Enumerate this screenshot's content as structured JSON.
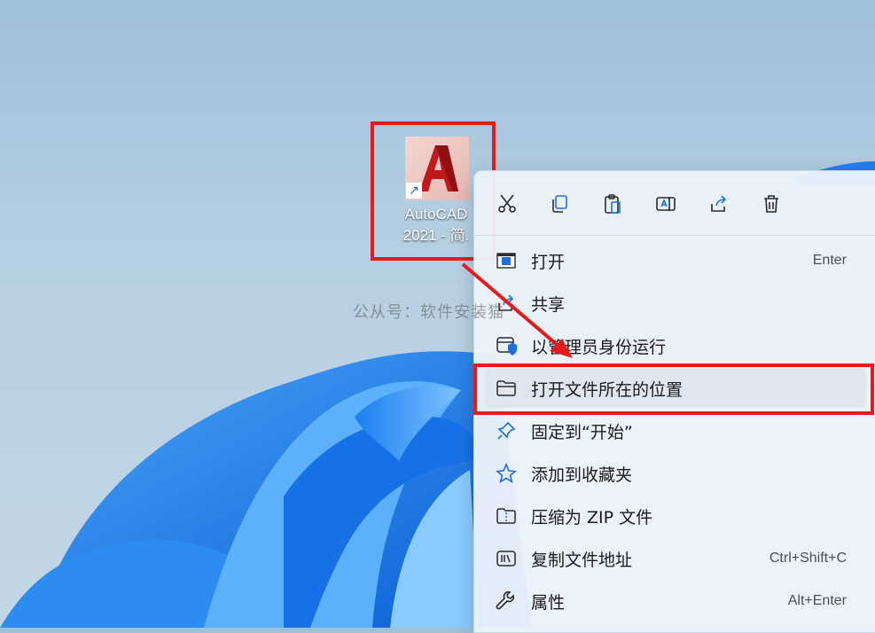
{
  "desktop": {
    "shortcut": {
      "name_line1": "AutoCAD",
      "name_line2": "2021 - 简.",
      "icon": "autocad-app-icon",
      "badge_icon": "shortcut-arrow-icon"
    },
    "watermark": "公从号：软件安装猫"
  },
  "context_menu": {
    "toolbar": [
      {
        "icon": "cut-icon"
      },
      {
        "icon": "copy-icon"
      },
      {
        "icon": "paste-icon"
      },
      {
        "icon": "rename-icon"
      },
      {
        "icon": "share-icon"
      },
      {
        "icon": "delete-icon"
      }
    ],
    "items": [
      {
        "label": "打开",
        "shortcut": "Enter",
        "icon": "open-app-icon"
      },
      {
        "label": "共享",
        "shortcut": "",
        "icon": "share-icon"
      },
      {
        "label": "以管理员身份运行",
        "shortcut": "",
        "icon": "admin-shield-icon"
      },
      {
        "label": "打开文件所在的位置",
        "shortcut": "",
        "icon": "folder-icon"
      },
      {
        "label": "固定到“开始”",
        "shortcut": "",
        "icon": "pin-icon"
      },
      {
        "label": "添加到收藏夹",
        "shortcut": "",
        "icon": "star-icon"
      },
      {
        "label": "压缩为 ZIP 文件",
        "shortcut": "",
        "icon": "zip-folder-icon"
      },
      {
        "label": "复制文件地址",
        "shortcut": "Ctrl+Shift+C",
        "icon": "copy-path-icon"
      },
      {
        "label": "属性",
        "shortcut": "Alt+Enter",
        "icon": "wrench-icon"
      }
    ]
  },
  "colors": {
    "annotation_red": "#e51b1b",
    "menu_bg": "#ecf2fa",
    "accent_blue": "#1d6fe0"
  }
}
